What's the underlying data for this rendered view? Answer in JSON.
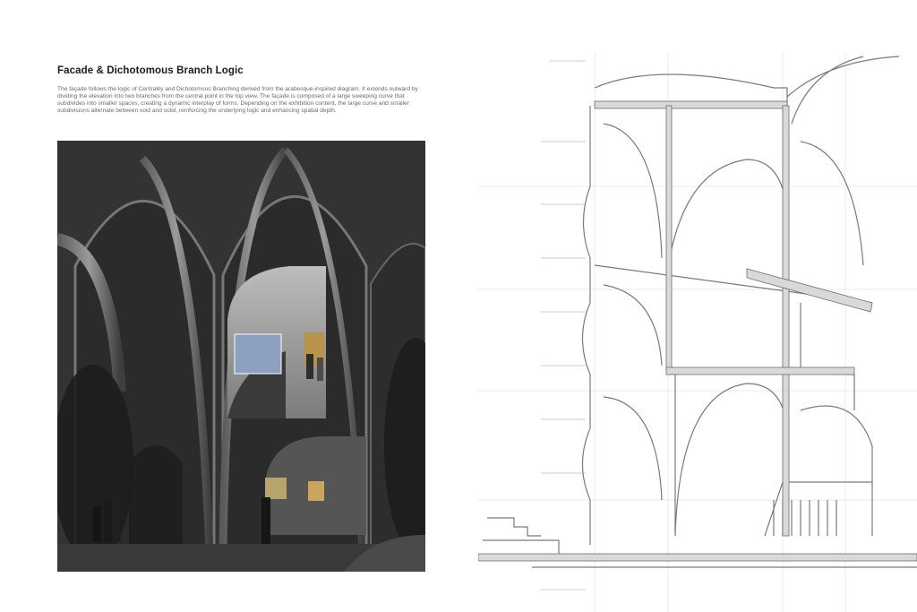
{
  "panel": {
    "title": "Facade & Dichotomous Branch Logic",
    "description": "The façade follows the logic of Centrality and Dichotomous Branching derived from the arabesque-inspired diagram. It extends outward by dividing the elevation into two branches from the central point in the top view. The façade is composed of a large sweeping curve that subdivides into smaller spaces, creating a dynamic interplay of forms. Depending on the exhibition content, the large curve and smaller subdivisions alternate between void and solid, reinforcing the underlying logic and enhancing spatial depth."
  },
  "colors": {
    "background": "#ffffff",
    "title": "#1b1b1b",
    "body_text": "#6a6a6a",
    "render_dark": "#2a2a2a",
    "drawing_line": "#7a7a7a",
    "drawing_fill": "#d9d9d9"
  }
}
